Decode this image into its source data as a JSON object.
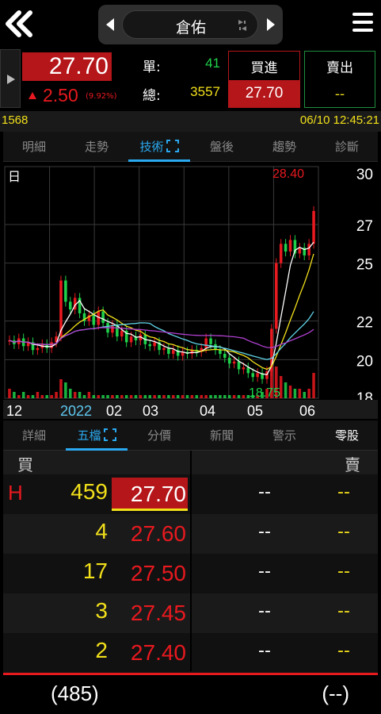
{
  "header": {
    "stock_name": "倉佑",
    "icons": [
      "back-double-chevron-icon",
      "prev-arrow-icon",
      "next-arrow-icon",
      "switch-icon",
      "hamburger-menu-icon"
    ]
  },
  "quote": {
    "price": "27.70",
    "change": "2.50",
    "change_pct": "(9.92%)",
    "single_label": "單:",
    "single_value": "41",
    "total_label": "總:",
    "total_value": "3557",
    "buy_label": "買進",
    "buy_price": "27.70",
    "sell_label": "賣出",
    "sell_price": "--"
  },
  "info": {
    "code": "1568",
    "datetime": "06/10 12:45:21"
  },
  "top_tabs": [
    {
      "label": "明細"
    },
    {
      "label": "走勢"
    },
    {
      "label": "技術"
    },
    {
      "label": "盤後"
    },
    {
      "label": "趨勢"
    },
    {
      "label": "診斷"
    }
  ],
  "chart_data": {
    "type": "candlestick",
    "period_label": "日",
    "high_label": "28.40",
    "low_label": "18.75",
    "y_ticks": [
      "30",
      "27",
      "25",
      "22",
      "20",
      "18"
    ],
    "ylim": [
      18,
      30
    ],
    "x_labels": [
      {
        "label": "12",
        "highlight": false
      },
      {
        "label": "2022",
        "highlight": true
      },
      {
        "label": "02",
        "highlight": false
      },
      {
        "label": "03",
        "highlight": false
      },
      {
        "label": "04",
        "highlight": false
      },
      {
        "label": "05",
        "highlight": false
      },
      {
        "label": "06",
        "highlight": false
      }
    ],
    "colors": {
      "up": "#e8191f",
      "down": "#1fd14a",
      "ma5": "#ffffff",
      "ma10": "#f2e01a",
      "ma20": "#5fd3e6",
      "ma60": "#b040d0",
      "grid": "#3a3a3a"
    },
    "candles": [
      {
        "c": 21.0
      },
      {
        "c": 20.8
      },
      {
        "c": 21.1
      },
      {
        "c": 20.7
      },
      {
        "c": 20.9
      },
      {
        "c": 20.5
      },
      {
        "c": 20.6
      },
      {
        "c": 20.8
      },
      {
        "c": 20.6
      },
      {
        "c": 20.9
      },
      {
        "c": 21.2
      },
      {
        "c": 24.1
      },
      {
        "c": 23.0
      },
      {
        "c": 22.6
      },
      {
        "c": 23.2
      },
      {
        "c": 22.4
      },
      {
        "c": 22.0
      },
      {
        "c": 22.3
      },
      {
        "c": 21.8
      },
      {
        "c": 22.5
      },
      {
        "c": 21.9
      },
      {
        "c": 21.4
      },
      {
        "c": 21.8
      },
      {
        "c": 21.2
      },
      {
        "c": 21.5
      },
      {
        "c": 20.9
      },
      {
        "c": 21.2
      },
      {
        "c": 21.0
      },
      {
        "c": 21.3
      },
      {
        "c": 20.8
      },
      {
        "c": 20.7
      },
      {
        "c": 20.9
      },
      {
        "c": 20.5
      },
      {
        "c": 20.6
      },
      {
        "c": 20.3
      },
      {
        "c": 20.5
      },
      {
        "c": 20.2
      },
      {
        "c": 20.4
      },
      {
        "c": 20.3
      },
      {
        "c": 20.5
      },
      {
        "c": 20.4
      },
      {
        "c": 20.6
      },
      {
        "c": 21.1
      },
      {
        "c": 20.8
      },
      {
        "c": 20.5
      },
      {
        "c": 20.3
      },
      {
        "c": 20.1
      },
      {
        "c": 19.8
      },
      {
        "c": 19.9
      },
      {
        "c": 19.5
      },
      {
        "c": 19.6
      },
      {
        "c": 19.3
      },
      {
        "c": 19.1
      },
      {
        "c": 19.3
      },
      {
        "c": 19.0
      },
      {
        "c": 19.4
      },
      {
        "c": 21.6
      },
      {
        "c": 25.0
      },
      {
        "c": 26.0
      },
      {
        "c": 25.6
      },
      {
        "c": 26.2
      },
      {
        "c": 25.5
      },
      {
        "c": 25.8
      },
      {
        "c": 25.4
      },
      {
        "c": 26.0
      },
      {
        "c": 27.7
      }
    ],
    "volumes": [
      0.3,
      0.2,
      0.1,
      0.2,
      0.1,
      0.1,
      0.2,
      0.1,
      0.1,
      0.1,
      0.2,
      0.6,
      0.5,
      0.3,
      0.2,
      0.2,
      0.1,
      0.2,
      0.1,
      0.1,
      0.1,
      0.1,
      0.1,
      0.1,
      0.1,
      0.1,
      0.1,
      0.1,
      0.1,
      0.1,
      0.1,
      0.1,
      0.1,
      0.1,
      0.1,
      0.1,
      0.1,
      0.1,
      0.1,
      0.1,
      0.1,
      0.1,
      0.1,
      0.1,
      0.1,
      0.1,
      0.1,
      0.1,
      0.1,
      0.1,
      0.1,
      0.1,
      0.1,
      0.1,
      0.2,
      0.3,
      0.9,
      1.0,
      0.7,
      0.5,
      0.4,
      0.3,
      0.3,
      0.2,
      0.3,
      0.8
    ]
  },
  "bottom_tabs": [
    {
      "label": "詳細"
    },
    {
      "label": "五檔"
    },
    {
      "label": "分價"
    },
    {
      "label": "新聞"
    },
    {
      "label": "警示"
    },
    {
      "label": "零股"
    }
  ],
  "order_book": {
    "buy_header": "買",
    "sell_header": "賣",
    "rows": [
      {
        "flag": "H",
        "bid_vol": "459",
        "bid_price": "27.70",
        "ask_price": "--",
        "ask_vol": "--"
      },
      {
        "flag": "",
        "bid_vol": "4",
        "bid_price": "27.60",
        "ask_price": "--",
        "ask_vol": "--"
      },
      {
        "flag": "",
        "bid_vol": "17",
        "bid_price": "27.50",
        "ask_price": "--",
        "ask_vol": "--"
      },
      {
        "flag": "",
        "bid_vol": "3",
        "bid_price": "27.45",
        "ask_price": "--",
        "ask_vol": "--"
      },
      {
        "flag": "",
        "bid_vol": "2",
        "bid_price": "27.40",
        "ask_price": "--",
        "ask_vol": "--"
      }
    ],
    "total_bid": "(485)",
    "total_ask": "(--)"
  }
}
